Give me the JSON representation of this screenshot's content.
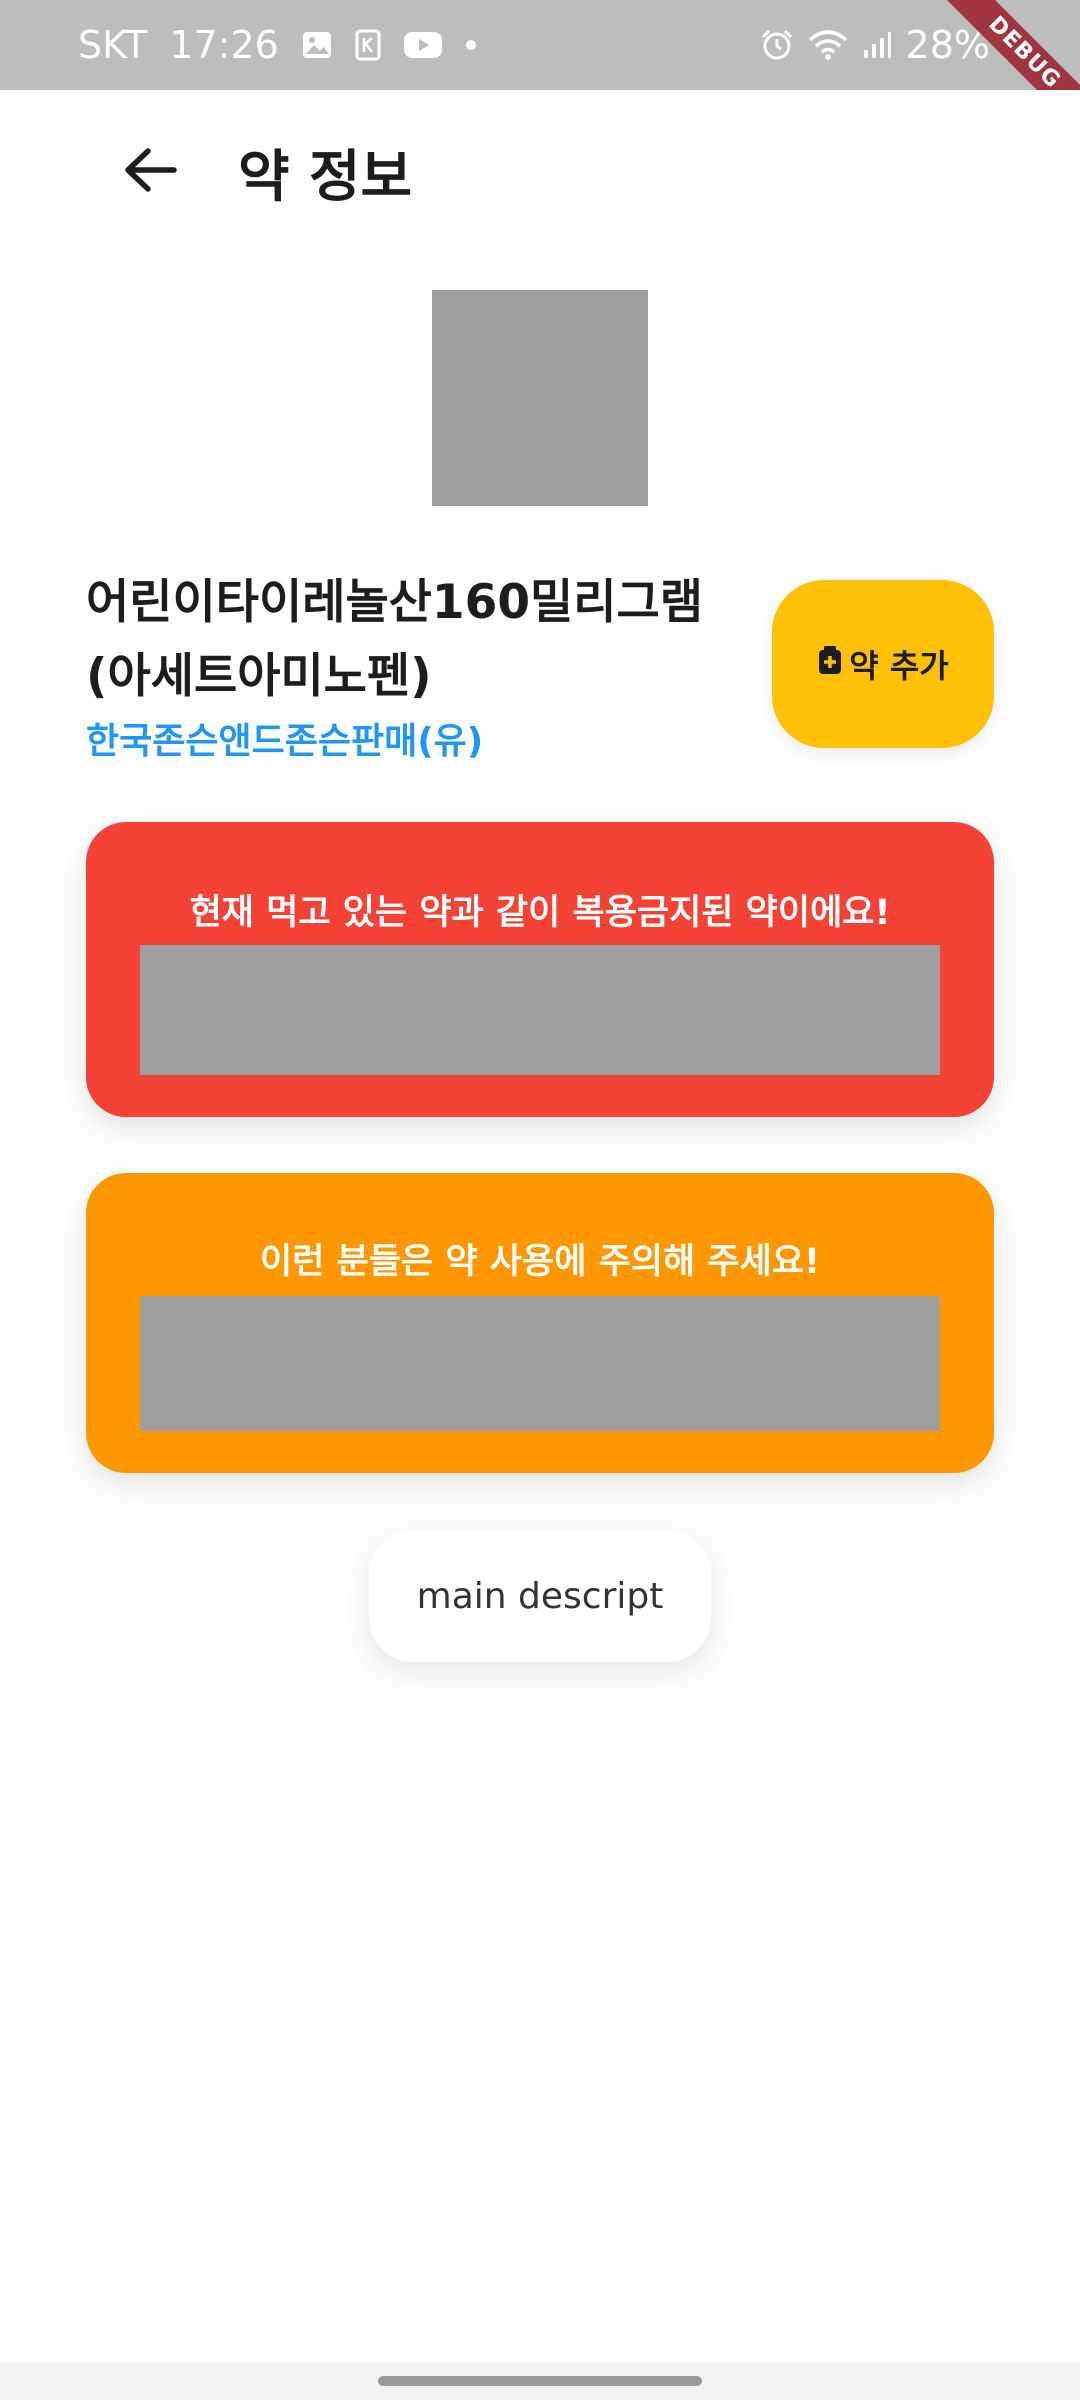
{
  "status_bar": {
    "carrier": "SKT",
    "time": "17:26",
    "battery": "28%",
    "debug_label": "DEBUG",
    "left_icons": [
      "image-icon",
      "k-box-icon",
      "youtube-icon",
      "dot-icon"
    ],
    "right_icons": [
      "alarm-icon",
      "wifi-icon",
      "signal-icon",
      "battery-icon"
    ]
  },
  "app_bar": {
    "title": "약 정보",
    "back_icon": "arrow-left-icon"
  },
  "drug": {
    "name": "어린이타이레놀산160밀리그램(아세트아미노펜)",
    "company": "한국존슨앤드존슨판매(유)",
    "add_button_label": "약 추가",
    "add_button_icon": "medicine-kit-icon"
  },
  "warnings": {
    "danger_title": "현재 먹고 있는 약과 같이 복용금지된 약이에요!",
    "caution_title": "이런 분들은 약 사용에 주의해 주세요!"
  },
  "main_description": {
    "label": "main descript"
  },
  "colors": {
    "status_bar": "#bdbdbd",
    "add_button": "#ffc107",
    "danger_card": "#f44336",
    "caution_card": "#ff9800",
    "company_text": "#2196f3",
    "placeholder": "#9e9e9e"
  }
}
